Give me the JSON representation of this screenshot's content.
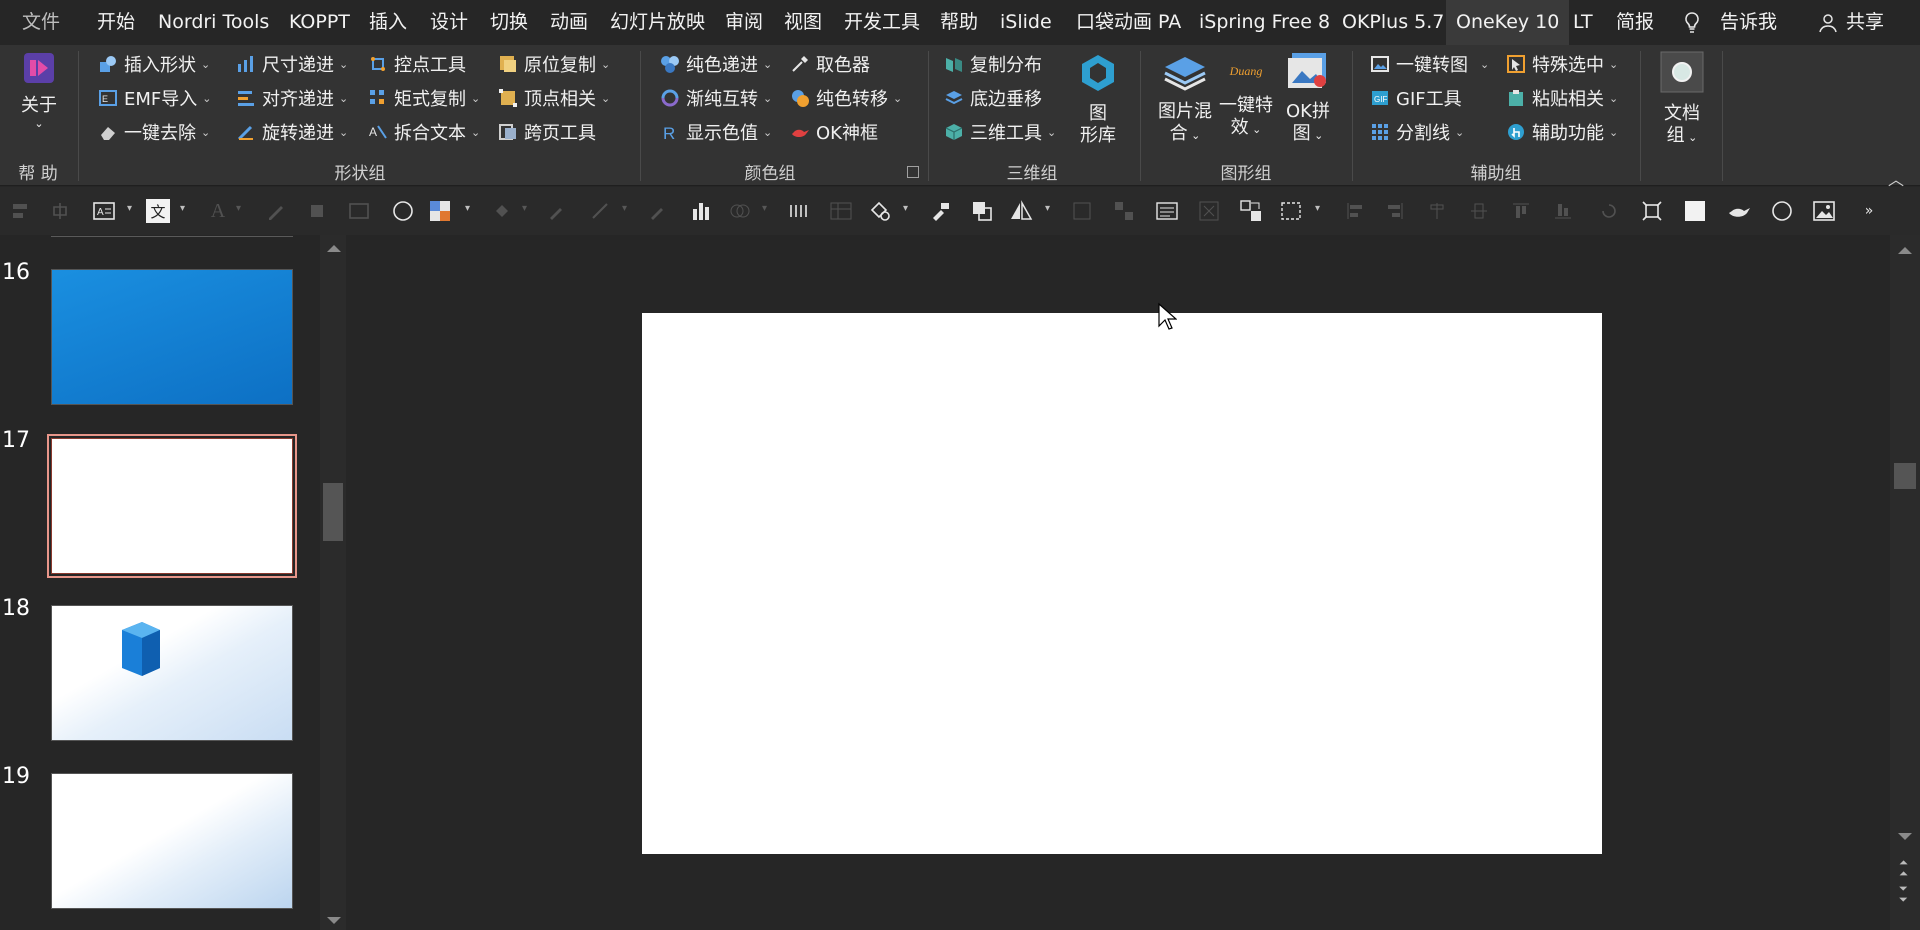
{
  "tabs": [
    "文件",
    "开始",
    "Nordri Tools",
    "KOPPT",
    "插入",
    "设计",
    "切换",
    "动画",
    "幻灯片放映",
    "审阅",
    "视图",
    "开发工具",
    "帮助",
    "iSlide",
    "口袋动画 PA",
    "iSpring Free 8",
    "OKPlus 5.7",
    "OneKey 10",
    "LT",
    "简报"
  ],
  "tell_me": "告诉我",
  "share": "共享",
  "groups": {
    "help": {
      "label": "帮 助",
      "about": "关于"
    },
    "shape": {
      "label": "形状组",
      "items": [
        "插入形状",
        "EMF导入",
        "一键去除",
        "尺寸递进",
        "对齐递进",
        "旋转递进",
        "控点工具",
        "矩式复制",
        "拆合文本",
        "原位复制",
        "顶点相关",
        "跨页工具"
      ]
    },
    "color": {
      "label": "颜色组",
      "items": [
        "纯色递进",
        "渐纯互转",
        "显示色值",
        "取色器",
        "纯色转移",
        "OK神框"
      ]
    },
    "three_d": {
      "label": "三维组",
      "items": [
        "复制分布",
        "底边垂移",
        "三维工具"
      ],
      "library_line1": "图",
      "library_line2": "形库"
    },
    "graphic": {
      "label": "图形组",
      "blend_line1": "图片混",
      "blend_line2": "合",
      "effect_line1": "一键特",
      "effect_line2": "效",
      "effect_logo": "Duang",
      "okpin_line1": "OK拼",
      "okpin_line2": "图"
    },
    "assist": {
      "label": "辅助组",
      "items": [
        "一键转图",
        "GIF工具",
        "分割线",
        "特殊选中",
        "粘贴相关",
        "辅助功能"
      ]
    },
    "doc": {
      "line1": "文档",
      "line2": "组"
    }
  },
  "slides": [
    {
      "number": "16"
    },
    {
      "number": "17"
    },
    {
      "number": "18"
    },
    {
      "number": "19"
    }
  ],
  "selected_slide": "17",
  "colors": {
    "accent_selected_border": "#e8968a",
    "blue_slide": "#1a8fe0"
  }
}
